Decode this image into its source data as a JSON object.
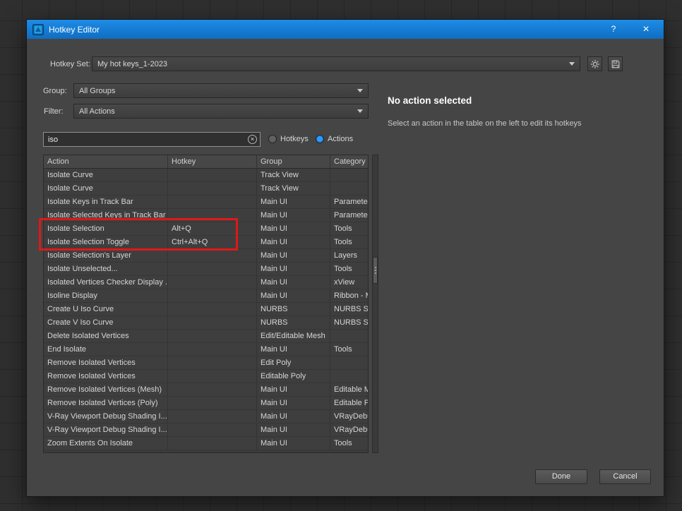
{
  "window": {
    "title": "Hotkey Editor",
    "help": "?",
    "close": "×"
  },
  "hotkey_set": {
    "label": "Hotkey Set:",
    "value": "My hot keys_1-2023"
  },
  "filters": {
    "group_label": "Group:",
    "group_value": "All Groups",
    "filter_label": "Filter:",
    "filter_value": "All Actions",
    "search_value": "iso",
    "hotkeys_radio": "Hotkeys",
    "actions_radio": "Actions",
    "selected_radio": "Actions"
  },
  "table": {
    "columns": [
      "Action",
      "Hotkey",
      "Group",
      "Category"
    ],
    "rows": [
      {
        "action": "Isolate Curve",
        "hotkey": "",
        "group": "Track View",
        "category": ""
      },
      {
        "action": "Isolate Curve",
        "hotkey": "",
        "group": "Track View",
        "category": ""
      },
      {
        "action": "Isolate Keys in Track Bar",
        "hotkey": "",
        "group": "Main UI",
        "category": "Parameter ."
      },
      {
        "action": "Isolate Selected Keys in Track Bar",
        "hotkey": "",
        "group": "Main UI",
        "category": "Parameter ."
      },
      {
        "action": "Isolate Selection",
        "hotkey": "Alt+Q",
        "group": "Main UI",
        "category": "Tools"
      },
      {
        "action": "Isolate Selection Toggle",
        "hotkey": "Ctrl+Alt+Q",
        "group": "Main UI",
        "category": "Tools"
      },
      {
        "action": "Isolate Selection's Layer",
        "hotkey": "",
        "group": "Main UI",
        "category": "Layers"
      },
      {
        "action": "Isolate Unselected...",
        "hotkey": "",
        "group": "Main UI",
        "category": "Tools"
      },
      {
        "action": "Isolated Vertices Checker Display ...",
        "hotkey": "",
        "group": "Main UI",
        "category": "xView"
      },
      {
        "action": "Isoline Display",
        "hotkey": "",
        "group": "Main UI",
        "category": "Ribbon - M."
      },
      {
        "action": "Create U Iso Curve",
        "hotkey": "",
        "group": "NURBS",
        "category": "NURBS Sur."
      },
      {
        "action": "Create V Iso Curve",
        "hotkey": "",
        "group": "NURBS",
        "category": "NURBS Sur."
      },
      {
        "action": "Delete Isolated Vertices",
        "hotkey": "",
        "group": "Edit/Editable Mesh",
        "category": ""
      },
      {
        "action": "End Isolate",
        "hotkey": "",
        "group": "Main UI",
        "category": "Tools"
      },
      {
        "action": "Remove Isolated Vertices",
        "hotkey": "",
        "group": "Edit Poly",
        "category": ""
      },
      {
        "action": "Remove Isolated Vertices",
        "hotkey": "",
        "group": "Editable Poly",
        "category": ""
      },
      {
        "action": "Remove Isolated Vertices (Mesh)",
        "hotkey": "",
        "group": "Main UI",
        "category": "Editable M.."
      },
      {
        "action": "Remove Isolated Vertices (Poly)",
        "hotkey": "",
        "group": "Main UI",
        "category": "Editable Po."
      },
      {
        "action": "V-Ray Viewport Debug Shading I...",
        "hotkey": "",
        "group": "Main UI",
        "category": "VRayDebu.."
      },
      {
        "action": "V-Ray Viewport Debug Shading I...",
        "hotkey": "",
        "group": "Main UI",
        "category": "VRayDebu.."
      },
      {
        "action": "Zoom Extents On Isolate",
        "hotkey": "",
        "group": "Main UI",
        "category": "Tools"
      }
    ]
  },
  "detail": {
    "title": "No action selected",
    "subtitle": "Select an action in the table on the left to edit its hotkeys"
  },
  "footer": {
    "done": "Done",
    "cancel": "Cancel"
  },
  "colors": {
    "titlebar_blue": "#1583DD",
    "annotation_red": "#E01818",
    "radio_selected_blue": "#2F9BFF",
    "dialog_bg": "#454545"
  }
}
